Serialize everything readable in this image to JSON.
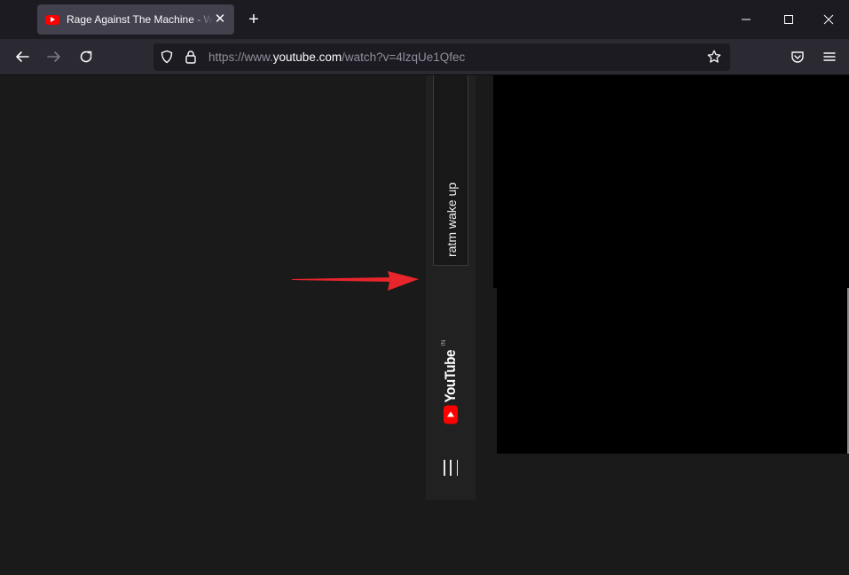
{
  "browser": {
    "tab": {
      "title": "Rage Against The Machine - Wake Up",
      "favicon": "youtube-favicon-icon"
    },
    "window_controls": [
      "minimize-icon",
      "maximize-icon",
      "close-icon"
    ],
    "url": {
      "scheme": "https://www.",
      "host": "youtube.com",
      "path": "/watch?v=4lzqUe1Qfec"
    }
  },
  "page": {
    "search_query": "ratm wake up",
    "logo": {
      "word": "YouTube",
      "country": "IN"
    },
    "menu_icon": "guide-menu-icon"
  },
  "colors": {
    "accent": "#ff0000",
    "annotation_arrow": "#e8252a",
    "page_bg": "#1a1a1a",
    "video_bg": "#000000"
  }
}
